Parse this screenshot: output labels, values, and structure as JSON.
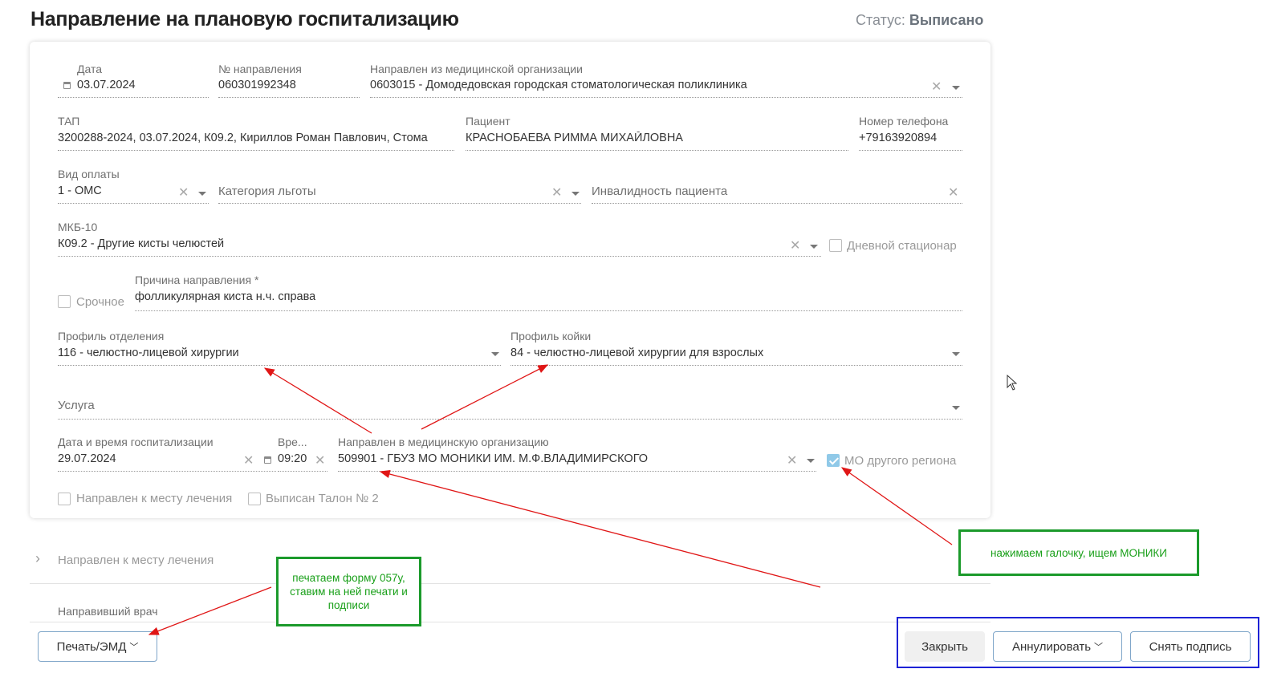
{
  "header": {
    "title": "Направление на плановую госпитализацию",
    "status_label": "Статус:",
    "status_value": "Выписано"
  },
  "form": {
    "date": {
      "label": "Дата",
      "value": "03.07.2024"
    },
    "referral_number": {
      "label": "№ направления",
      "value": "060301992348"
    },
    "from_org": {
      "label": "Направлен из медицинской организации",
      "value": "0603015 - Домодедовская городская стоматологическая поликлиника"
    },
    "tap": {
      "label": "ТАП",
      "value": "3200288-2024, 03.07.2024, К09.2, Кириллов Роман Павлович, Стома"
    },
    "patient": {
      "label": "Пациент",
      "value": "КРАСНОБАЕВА РИММА МИХАЙЛОВНА"
    },
    "phone": {
      "label": "Номер телефона",
      "value": "+79163920894"
    },
    "payment": {
      "label": "Вид оплаты",
      "value": "1 - ОМС"
    },
    "benefit_category": {
      "placeholder": "Категория льготы"
    },
    "disability": {
      "placeholder": "Инвалидность пациента"
    },
    "mkb": {
      "label": "МКБ-10",
      "value": "К09.2 - Другие кисты челюстей"
    },
    "day_hospital": {
      "label": "Дневной стационар",
      "checked": false
    },
    "urgent": {
      "label": "Срочное",
      "checked": false
    },
    "reason": {
      "label": "Причина направления *",
      "value": "фолликулярная киста н.ч. справа"
    },
    "department_profile": {
      "label": "Профиль отделения",
      "value": "116 - челюстно-лицевой хирургии"
    },
    "bed_profile": {
      "label": "Профиль койки",
      "value": "84 - челюстно-лицевой хирургии для взрослых"
    },
    "service": {
      "placeholder": "Услуга"
    },
    "hosp_date": {
      "label": "Дата и время госпитализации",
      "value": "29.07.2024"
    },
    "hosp_time": {
      "label": "Вре...",
      "value": "09:20"
    },
    "to_org": {
      "label": "Направлен в медицинскую организацию",
      "value": "509901 - ГБУЗ МО МОНИКИ ИМ. М.Ф.ВЛАДИМИРСКОГО"
    },
    "other_region": {
      "label": "МО другого региона",
      "checked": true
    },
    "to_treatment_place": {
      "label": "Направлен к месту лечения",
      "checked": false
    },
    "talon": {
      "label": "Выписан Талон № 2",
      "checked": false
    }
  },
  "sections": {
    "treatment_place": "Направлен к месту лечения",
    "referring_doctor": "Направивший врач"
  },
  "buttons": {
    "print": "Печать/ЭМД",
    "close": "Закрыть",
    "annul": "Аннулировать",
    "remove_signature": "Снять подпись"
  },
  "annotations": {
    "note_print": "печатаем форму 057у, ставим на ней печати и подписи",
    "note_moniki": "нажимаем галочку, ищем МОНИКИ"
  },
  "colors": {
    "arrow": "#e01616",
    "note_border": "#1b9a2b",
    "frame_blue": "#1e22d6",
    "button_border": "#7fa6c9",
    "checkbox_checked": "#90c9e8"
  }
}
